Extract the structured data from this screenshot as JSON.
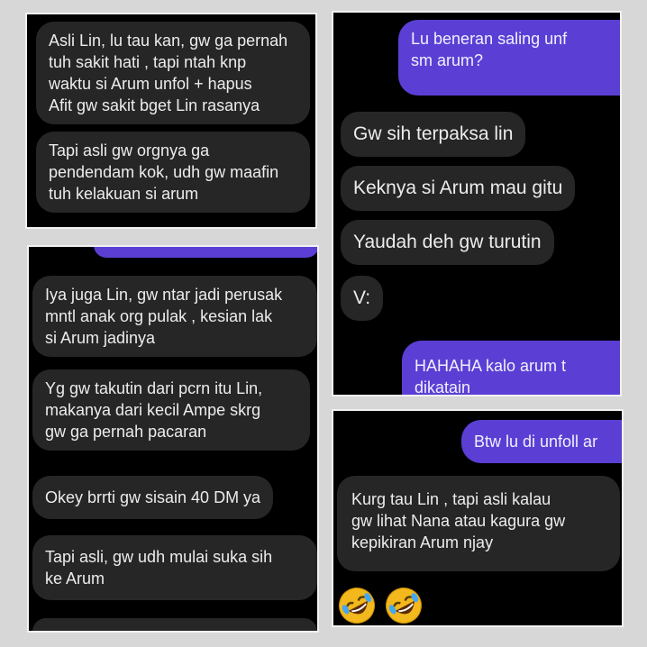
{
  "panel1": {
    "messages": [
      "Asli Lin, lu tau kan, gw ga pernah\ntuh sakit hati , tapi ntah knp\nwaktu si Arum unfol + hapus\nAfit gw  sakit bget Lin rasanya",
      "Tapi asli gw orgnya ga\npendendam kok, udh gw maafin\ntuh kelakuan si arum"
    ]
  },
  "panel2": {
    "sent_1": "Lu beneran saling unf\nsm arum?",
    "messages": [
      "Gw sih terpaksa lin",
      "Keknya si Arum mau gitu",
      "Yaudah deh gw turutin",
      "V:"
    ],
    "sent_2": "HAHAHA kalo arum t\ndikatain"
  },
  "panel3": {
    "messages": [
      "Iya juga Lin, gw ntar jadi perusak\nmntl anak org pulak ,  kesian lak\nsi Arum jadinya",
      "Yg gw takutin dari pcrn itu Lin,\nmakanya dari kecil Ampe skrg\ngw ga pernah pacaran",
      "Okey brrti gw sisain 40 DM ya",
      "Tapi asli, gw udh mulai suka sih\nke Arum"
    ]
  },
  "panel4": {
    "sent_1": "Btw lu di unfoll ar",
    "messages": [
      "Kurg tau Lin , tapi asli kalau\ngw lihat Nana atau kagura gw\nkepikiran Arum njay"
    ],
    "emojis": [
      "rolling-on-floor-laughing",
      "rolling-on-floor-laughing"
    ]
  },
  "colors": {
    "background": "#d7d7d7",
    "panel": "#000000",
    "received_bubble": "#262626",
    "sent_bubble": "#5b3fd4",
    "text": "#ececec"
  }
}
